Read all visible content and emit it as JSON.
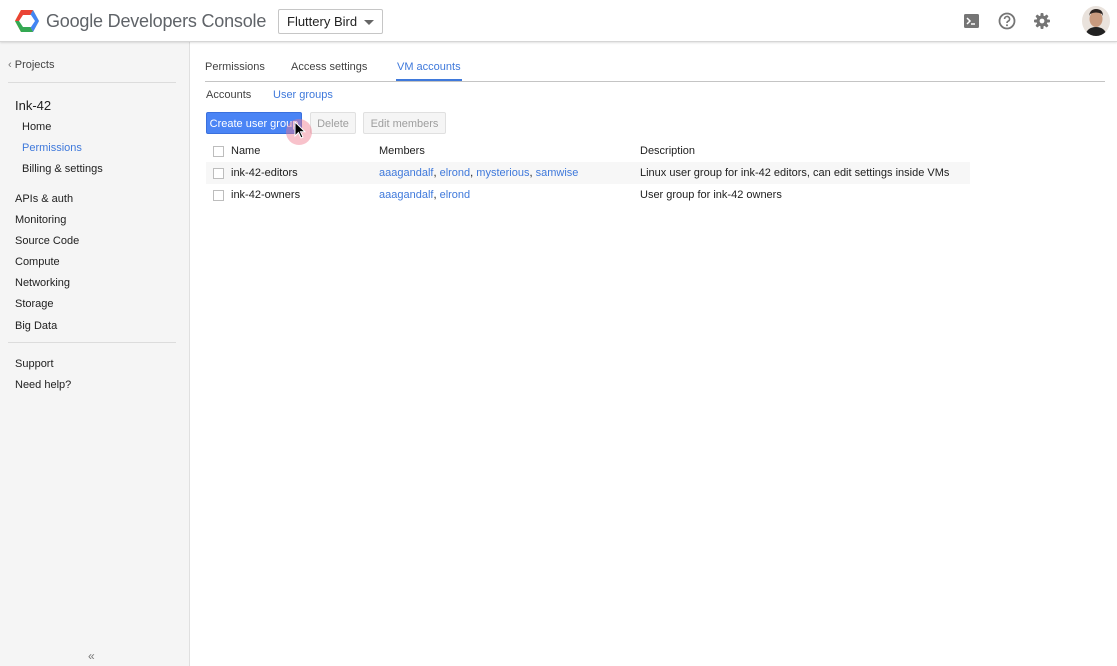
{
  "header": {
    "brand": "Google Developers Console",
    "project": "Fluttery Bird",
    "icons": [
      "cloud-shell-icon",
      "help-icon",
      "settings-icon",
      "avatar"
    ]
  },
  "sidebar": {
    "back_link": "Projects",
    "project_name": "Ink-42",
    "project_items": [
      {
        "label": "Home",
        "active": false
      },
      {
        "label": "Permissions",
        "active": true
      },
      {
        "label": "Billing & settings",
        "active": false
      }
    ],
    "sections": [
      "APIs & auth",
      "Monitoring",
      "Source Code",
      "Compute",
      "Networking",
      "Storage",
      "Big Data"
    ],
    "footer": [
      "Support",
      "Need help?"
    ],
    "collapse_glyph": "«"
  },
  "tabs": [
    {
      "label": "Permissions",
      "active": false
    },
    {
      "label": "Access settings",
      "active": false
    },
    {
      "label": "VM accounts",
      "active": true
    }
  ],
  "subtabs": [
    {
      "label": "Accounts",
      "active": false
    },
    {
      "label": "User groups",
      "active": true
    }
  ],
  "actions": {
    "create": "Create user group",
    "delete": "Delete",
    "edit": "Edit members"
  },
  "table": {
    "columns": [
      "Name",
      "Members",
      "Description"
    ],
    "rows": [
      {
        "name": "ink-42-editors",
        "members": [
          "aaagandalf",
          "elrond",
          "mysterious",
          "samwise"
        ],
        "description": "Linux user group for ink-42 editors, can edit settings inside VMs"
      },
      {
        "name": "ink-42-owners",
        "members": [
          "aaagandalf",
          "elrond"
        ],
        "description": "User group for ink-42 owners"
      }
    ]
  },
  "colors": {
    "accent": "#3f79db",
    "primary_button": "#4a84f5",
    "sidebar_bg": "#f5f5f5"
  }
}
